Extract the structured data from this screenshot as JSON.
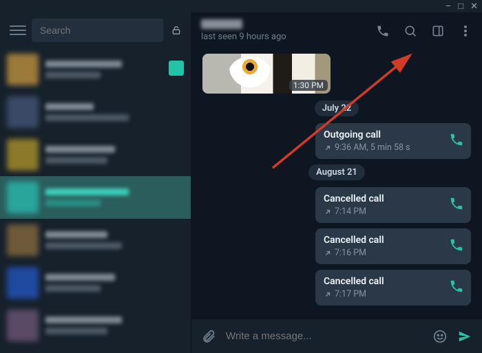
{
  "window": {
    "minimize": "–",
    "maximize": "□",
    "close": "✕"
  },
  "sidebar": {
    "search_placeholder": "Search"
  },
  "chat": {
    "last_seen": "last seen 9 hours ago",
    "media_time": "1:30 PM",
    "dates": {
      "d1": "July 22",
      "d2": "August 21"
    },
    "calls": [
      {
        "title": "Outgoing call",
        "meta": "9:36 AM, 5 min 58 s"
      },
      {
        "title": "Cancelled call",
        "meta": "7:14 PM"
      },
      {
        "title": "Cancelled call",
        "meta": "7:16 PM"
      },
      {
        "title": "Cancelled call",
        "meta": "7:17 PM"
      }
    ]
  },
  "composer": {
    "placeholder": "Write a message..."
  },
  "colors": {
    "accent": "#27c3a5",
    "bubble": "#2b3847",
    "arrow": "#d23a2a"
  }
}
